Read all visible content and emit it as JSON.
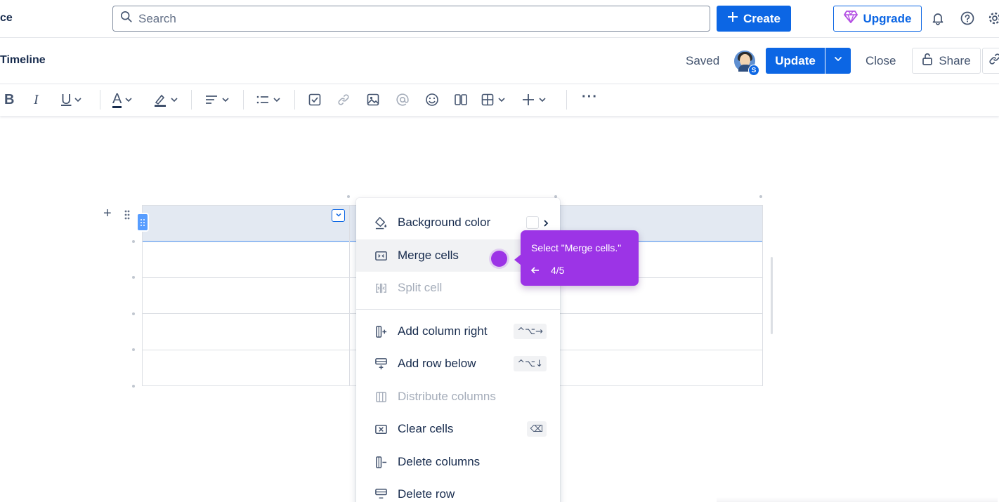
{
  "topbar": {
    "brand_fragment": "ce",
    "search_placeholder": "Search",
    "create_label": "Create",
    "upgrade_label": "Upgrade"
  },
  "editor_header": {
    "page_title": "Timeline",
    "saved_label": "Saved",
    "avatar_badge": "S",
    "update_label": "Update",
    "close_label": "Close",
    "share_label": "Share"
  },
  "toolbar": {
    "bold": "B",
    "italic": "I",
    "underline": "U",
    "text_color": "A",
    "more": "···",
    "icons": [
      "bold-icon",
      "italic-icon",
      "underline-icon",
      "text-color-icon",
      "highlight-icon",
      "align-icon",
      "list-icon",
      "task-icon",
      "link-icon",
      "image-icon",
      "mention-icon",
      "emoji-icon",
      "layouts-icon",
      "table-icon",
      "insert-icon",
      "more-icon"
    ]
  },
  "context_menu": {
    "items": [
      {
        "label": "Background color",
        "icon": "paint-bucket-icon",
        "disabled": false
      },
      {
        "label": "Merge cells",
        "icon": "merge-cells-icon",
        "disabled": false,
        "highlighted": true
      },
      {
        "label": "Split cell",
        "icon": "split-cell-icon",
        "disabled": true
      },
      {
        "label": "Add column right",
        "icon": "add-column-icon",
        "disabled": false,
        "shortcut": "^⌥→"
      },
      {
        "label": "Add row below",
        "icon": "add-row-icon",
        "disabled": false,
        "shortcut": "^⌥↓"
      },
      {
        "label": "Distribute columns",
        "icon": "distribute-columns-icon",
        "disabled": true
      },
      {
        "label": "Clear cells",
        "icon": "clear-cells-icon",
        "disabled": false,
        "shortcut": "⌫"
      },
      {
        "label": "Delete columns",
        "icon": "delete-columns-icon",
        "disabled": false
      },
      {
        "label": "Delete row",
        "icon": "delete-row-icon",
        "disabled": false
      }
    ]
  },
  "guide": {
    "instruction": "Select \"Merge cells.\"",
    "step": "4/5"
  },
  "colors": {
    "primary": "#0c66e4",
    "guide_purple": "#9c34e6",
    "selection_bg": "#e3e9f2",
    "selection_border": "#579dff"
  }
}
